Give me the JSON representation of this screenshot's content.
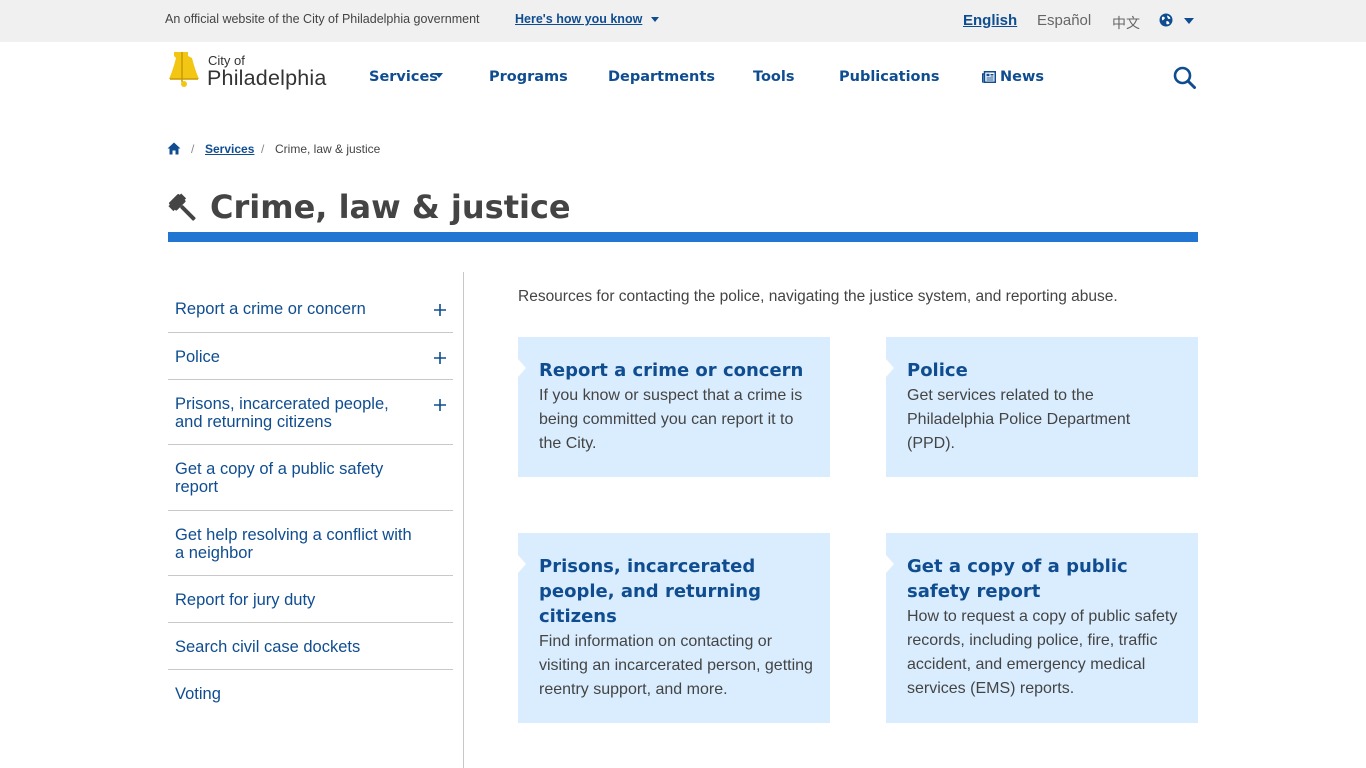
{
  "topbar": {
    "official_text": "An official website of the City of Philadelphia government",
    "how_you_know": "Here's how you know",
    "languages": [
      "English",
      "Español",
      "中文"
    ]
  },
  "logo": {
    "line1": "City of",
    "line2": "Philadelphia"
  },
  "nav": {
    "items": [
      "Services",
      "Programs",
      "Departments",
      "Tools",
      "Publications",
      "News"
    ]
  },
  "breadcrumb": {
    "parent": "Services",
    "current": "Crime, law & justice"
  },
  "page": {
    "title": "Crime, law & justice",
    "intro": "Resources for contacting the police, navigating the justice system, and reporting abuse."
  },
  "sidebar": {
    "items": [
      {
        "label": "Report a crime or concern",
        "expandable": true
      },
      {
        "label": "Police",
        "expandable": true
      },
      {
        "label": "Prisons, incarcerated people, and returning citizens",
        "expandable": true
      },
      {
        "label": "Get a copy of a public safety report",
        "expandable": false
      },
      {
        "label": "Get help resolving a conflict with a neighbor",
        "expandable": false
      },
      {
        "label": "Report for jury duty",
        "expandable": false
      },
      {
        "label": "Search civil case dockets",
        "expandable": false
      },
      {
        "label": "Voting",
        "expandable": false
      }
    ]
  },
  "cards": [
    {
      "title": "Report a crime or concern",
      "description": "If you know or suspect that a crime is being committed you can report it to the City."
    },
    {
      "title": "Police",
      "description": "Get services related to the Philadelphia Police Department (PPD)."
    },
    {
      "title": "Prisons, incarcerated people, and returning citizens",
      "description": "Find information on contacting or visiting an incarcerated person, getting reentry support, and more."
    },
    {
      "title": "Get a copy of a public safety report",
      "description": "How to request a copy of public safety records, including police, fire, traffic accident, and emergency medical services (EMS) reports."
    }
  ],
  "colors": {
    "brand_blue": "#0f4d90",
    "accent_blue": "#2176d2",
    "card_bg": "#daedfe",
    "logo_yellow": "#f3c613"
  },
  "icons": [
    "chevron-down-icon",
    "globe-icon",
    "liberty-bell-logo",
    "newspaper-icon",
    "search-icon",
    "home-icon",
    "gavel-icon",
    "plus-icon"
  ]
}
